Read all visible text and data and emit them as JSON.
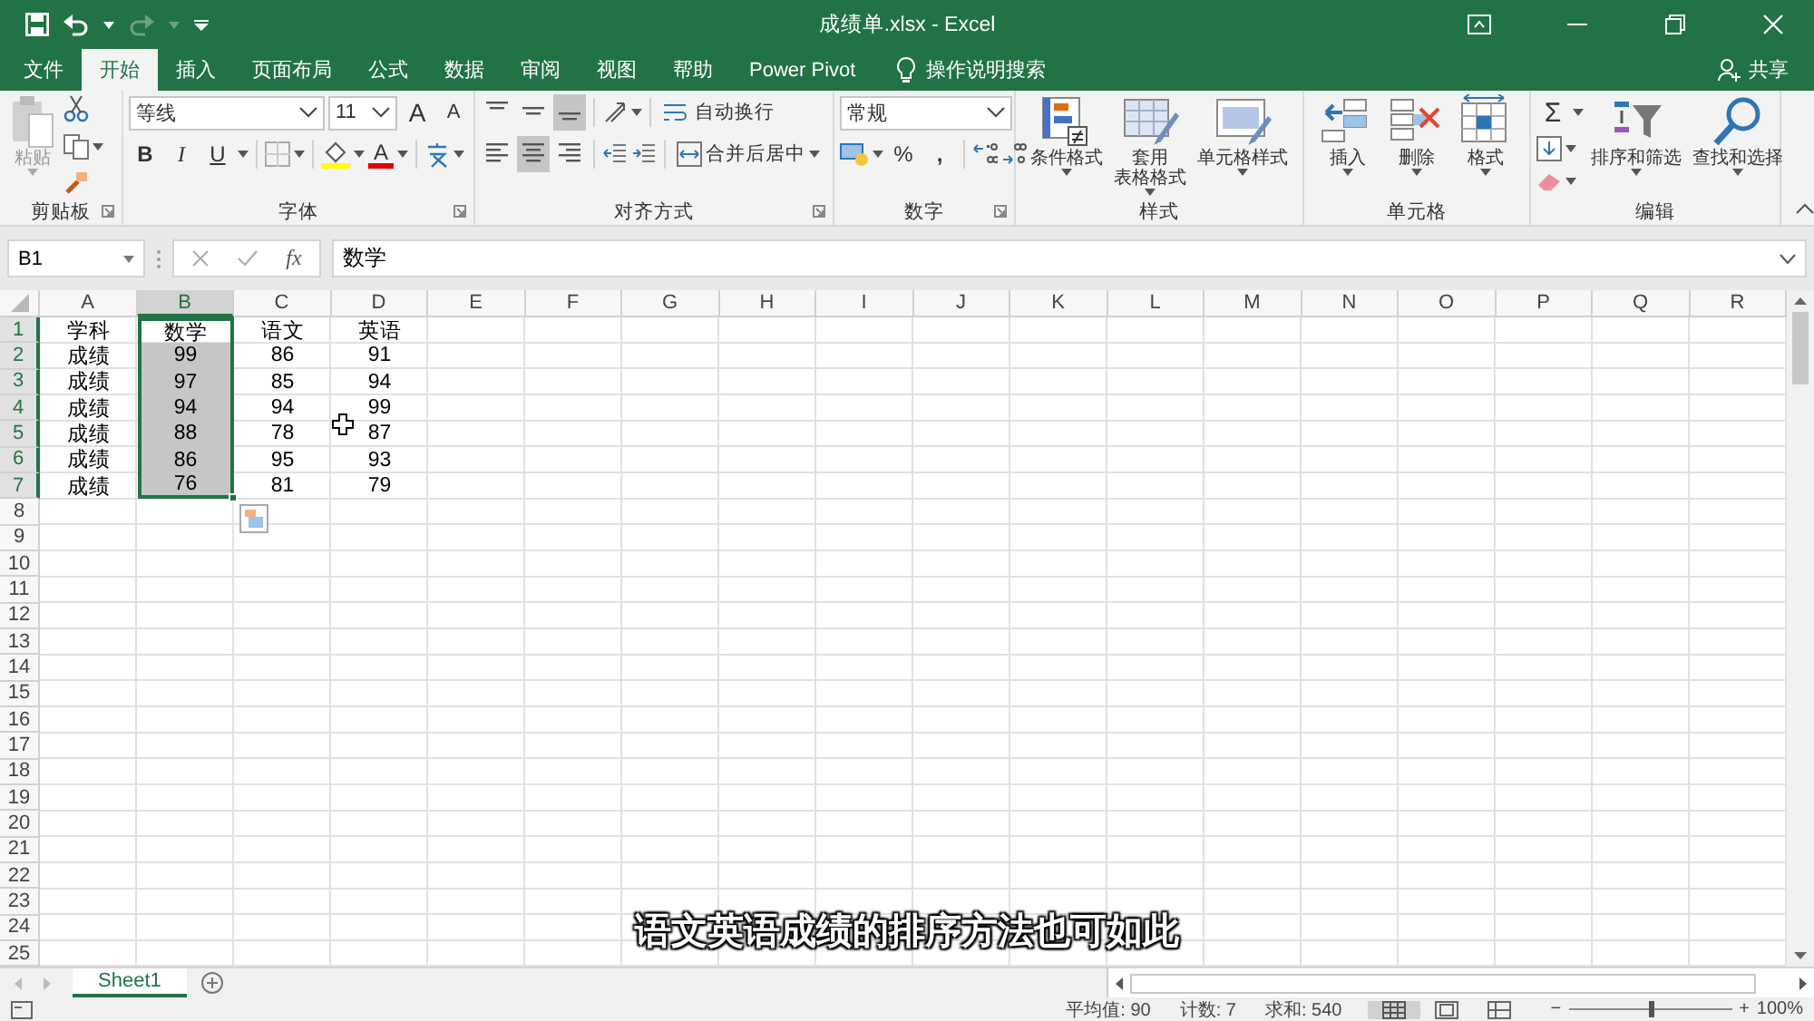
{
  "title_bar": {
    "title": "成绩单.xlsx  -  Excel"
  },
  "tabs": [
    {
      "label": "文件",
      "selected": false
    },
    {
      "label": "开始",
      "selected": true
    },
    {
      "label": "插入",
      "selected": false
    },
    {
      "label": "页面布局",
      "selected": false
    },
    {
      "label": "公式",
      "selected": false
    },
    {
      "label": "数据",
      "selected": false
    },
    {
      "label": "审阅",
      "selected": false
    },
    {
      "label": "视图",
      "selected": false
    },
    {
      "label": "帮助",
      "selected": false
    },
    {
      "label": "Power Pivot",
      "selected": false
    }
  ],
  "search": {
    "placeholder": "操作说明搜索"
  },
  "share": {
    "label": "共享"
  },
  "ribbon": {
    "groups": [
      {
        "kind": "clipboard",
        "label": "剪贴板",
        "paste": {
          "label": "粘贴",
          "disabled": true
        }
      },
      {
        "kind": "font",
        "label": "字体",
        "font_name": "等线",
        "font_size": "11",
        "grow": "A",
        "shrink": "A",
        "styles": [
          "B",
          "I",
          "U"
        ],
        "font_color": "A"
      },
      {
        "kind": "alignment",
        "label": "对齐方式",
        "vertical": [
          {
            "selected": false
          },
          {
            "selected": false
          },
          {
            "selected": true
          }
        ],
        "horizontal": [
          {
            "selected": false
          },
          {
            "selected": true
          },
          {
            "selected": false
          }
        ],
        "wrap": "自动换行",
        "merge": "合并后居中"
      },
      {
        "kind": "number",
        "label": "数字",
        "format": "常规",
        "percent": "%",
        "comma": ","
      },
      {
        "kind": "buttons",
        "label": "样式",
        "buttons": [
          {
            "kind": "conditional-format",
            "lines": [
              "条件格式"
            ]
          },
          {
            "kind": "table-format",
            "lines": [
              "套用",
              "表格格式"
            ]
          },
          {
            "kind": "cell-styles",
            "lines": [
              "单元格样式"
            ]
          }
        ]
      },
      {
        "kind": "buttons",
        "label": "单元格",
        "buttons": [
          {
            "kind": "insert",
            "lines": [
              "插入"
            ]
          },
          {
            "kind": "delete",
            "lines": [
              "删除"
            ]
          },
          {
            "kind": "format",
            "lines": [
              "格式"
            ]
          }
        ]
      },
      {
        "kind": "editing",
        "label": "编辑",
        "sum": "Σ",
        "buttons": [
          {
            "kind": "sort-filter",
            "lines": [
              "排序和筛选"
            ]
          },
          {
            "kind": "find",
            "lines": [
              "查找和选择"
            ]
          }
        ]
      }
    ]
  },
  "formula_bar": {
    "name_box": "B1",
    "fx": "fx",
    "formula": "数学"
  },
  "sheet": {
    "columns": [
      {
        "label": "A",
        "selected": false
      },
      {
        "label": "B",
        "selected": true
      },
      {
        "label": "C",
        "selected": false
      },
      {
        "label": "D",
        "selected": false
      },
      {
        "label": "E",
        "selected": false
      },
      {
        "label": "F",
        "selected": false
      },
      {
        "label": "G",
        "selected": false
      },
      {
        "label": "H",
        "selected": false
      },
      {
        "label": "I",
        "selected": false
      },
      {
        "label": "J",
        "selected": false
      },
      {
        "label": "K",
        "selected": false
      },
      {
        "label": "L",
        "selected": false
      },
      {
        "label": "M",
        "selected": false
      },
      {
        "label": "N",
        "selected": false
      },
      {
        "label": "O",
        "selected": false
      },
      {
        "label": "P",
        "selected": false
      },
      {
        "label": "Q",
        "selected": false
      },
      {
        "label": "R",
        "selected": false
      }
    ],
    "rows": [
      {
        "number": "1",
        "selected": true,
        "cells": [
          {
            "text": "学科",
            "selected": false
          },
          {
            "text": "数学",
            "selected": false
          },
          {
            "text": "语文",
            "selected": false
          },
          {
            "text": "英语",
            "selected": false
          }
        ]
      },
      {
        "number": "2",
        "selected": true,
        "cells": [
          {
            "text": "成绩",
            "selected": false
          },
          {
            "text": "99",
            "selected": true
          },
          {
            "text": "86",
            "selected": false
          },
          {
            "text": "91",
            "selected": false
          }
        ]
      },
      {
        "number": "3",
        "selected": true,
        "cells": [
          {
            "text": "成绩",
            "selected": false
          },
          {
            "text": "97",
            "selected": true
          },
          {
            "text": "85",
            "selected": false
          },
          {
            "text": "94",
            "selected": false
          }
        ]
      },
      {
        "number": "4",
        "selected": true,
        "cells": [
          {
            "text": "成绩",
            "selected": false
          },
          {
            "text": "94",
            "selected": true
          },
          {
            "text": "94",
            "selected": false
          },
          {
            "text": "99",
            "selected": false
          }
        ]
      },
      {
        "number": "5",
        "selected": true,
        "cells": [
          {
            "text": "成绩",
            "selected": false
          },
          {
            "text": "88",
            "selected": true
          },
          {
            "text": "78",
            "selected": false
          },
          {
            "text": "87",
            "selected": false
          }
        ]
      },
      {
        "number": "6",
        "selected": true,
        "cells": [
          {
            "text": "成绩",
            "selected": false
          },
          {
            "text": "86",
            "selected": true
          },
          {
            "text": "95",
            "selected": false
          },
          {
            "text": "93",
            "selected": false
          }
        ]
      },
      {
        "number": "7",
        "selected": true,
        "cells": [
          {
            "text": "成绩",
            "selected": false
          },
          {
            "text": "76",
            "selected": true
          },
          {
            "text": "81",
            "selected": false
          },
          {
            "text": "79",
            "selected": false
          }
        ]
      },
      {
        "number": "8",
        "selected": false
      },
      {
        "number": "9",
        "selected": false
      },
      {
        "number": "10",
        "selected": false
      },
      {
        "number": "11",
        "selected": false
      },
      {
        "number": "12",
        "selected": false
      },
      {
        "number": "13",
        "selected": false
      },
      {
        "number": "14",
        "selected": false
      },
      {
        "number": "15",
        "selected": false
      },
      {
        "number": "16",
        "selected": false
      },
      {
        "number": "17",
        "selected": false
      },
      {
        "number": "18",
        "selected": false
      },
      {
        "number": "19",
        "selected": false
      },
      {
        "number": "20",
        "selected": false
      },
      {
        "number": "21",
        "selected": false
      },
      {
        "number": "22",
        "selected": false
      },
      {
        "number": "23",
        "selected": false
      },
      {
        "number": "24",
        "selected": false
      },
      {
        "number": "25",
        "selected": false
      }
    ]
  },
  "subtitle": "语文英语成绩的排序方法也可如此",
  "sheet_tabs": [
    {
      "label": "Sheet1",
      "selected": true
    }
  ],
  "status_bar": {
    "stats": [
      "平均值: 90",
      "计数: 7",
      "求和: 540"
    ],
    "views": [
      {
        "selected": true
      },
      {
        "selected": false
      },
      {
        "selected": false
      }
    ],
    "zoom": {
      "minus": "−",
      "plus": "+",
      "level": 0.5,
      "reading": "100%"
    }
  }
}
